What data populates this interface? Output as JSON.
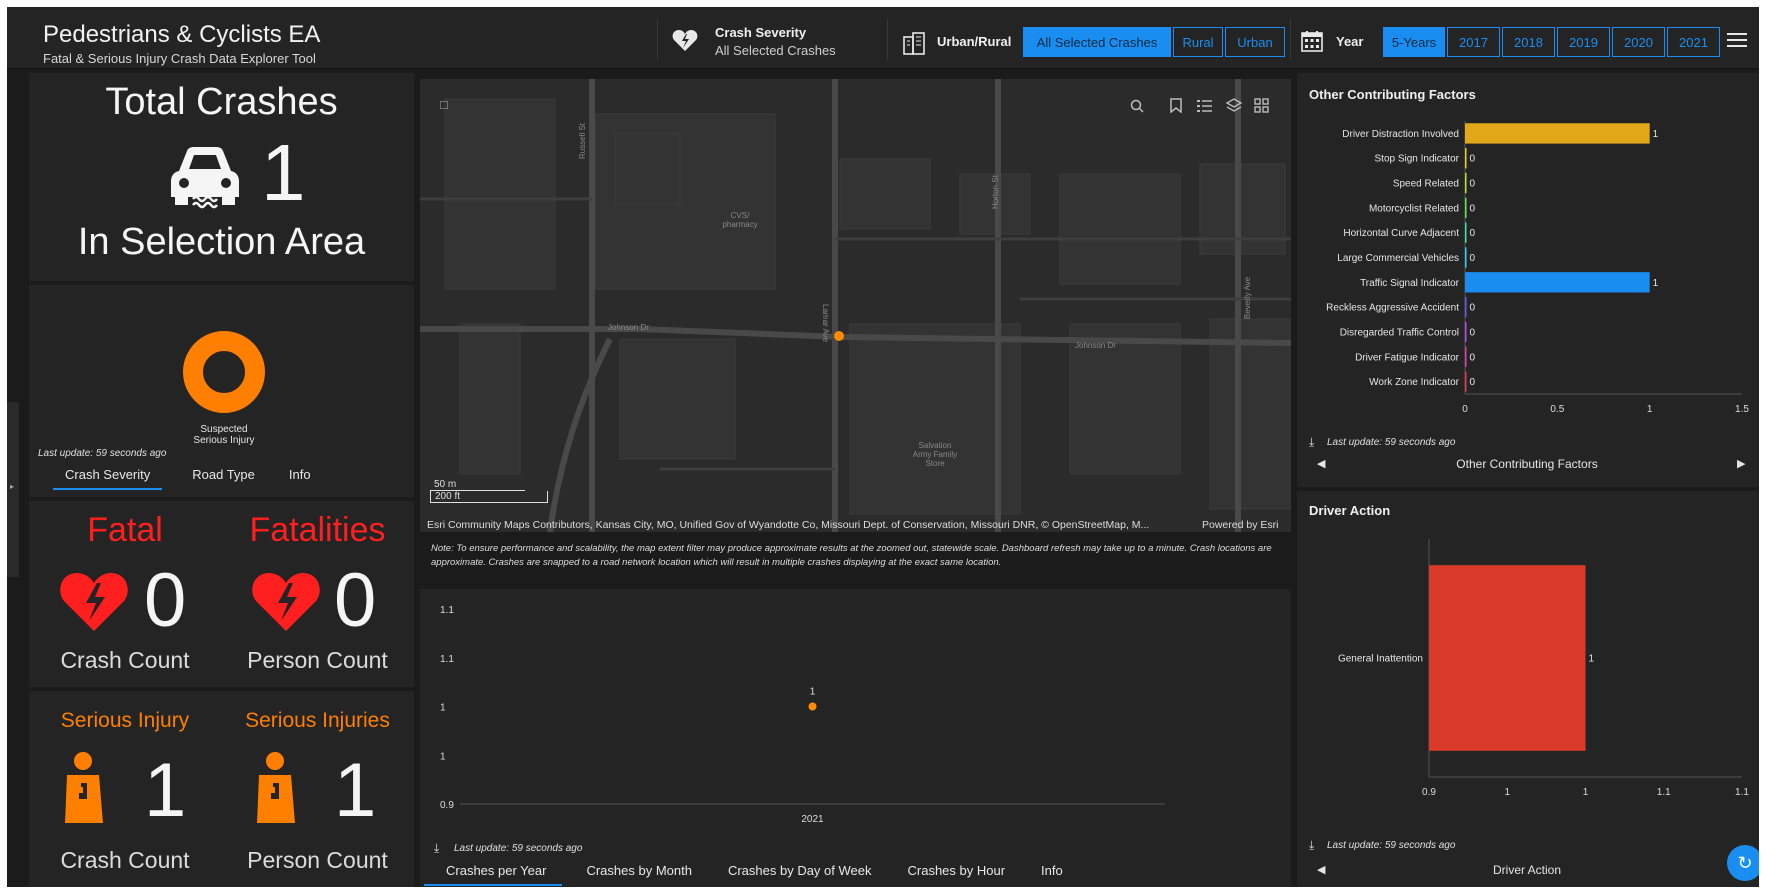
{
  "header": {
    "title": "Pedestrians & Cyclists EA",
    "subtitle": "Fatal & Serious Injury Crash Data Explorer Tool",
    "severity_label": "Crash Severity",
    "severity_value": "All Selected Crashes",
    "urban_rural_label": "Urban/Rural",
    "urban_rural_options": [
      "All Selected Crashes",
      "Rural",
      "Urban"
    ],
    "urban_rural_selected": "All Selected Crashes",
    "year_label": "Year",
    "year_options": [
      "5-Years",
      "2017",
      "2018",
      "2019",
      "2020",
      "2021"
    ],
    "year_selected": "5-Years"
  },
  "total": {
    "title": "Total Crashes",
    "count": "1",
    "subtitle": "In Selection Area"
  },
  "severity_chart": {
    "label_line1": "Suspected",
    "label_line2": "Serious Injury",
    "last_update": "Last update: 59 seconds ago",
    "tabs": [
      "Crash Severity",
      "Road Type",
      "Info"
    ],
    "active_tab": "Crash Severity",
    "slices": [
      {
        "label": "Suspected Serious Injury",
        "value": 1,
        "color": "#ff7f00"
      }
    ]
  },
  "fatal": {
    "title_left": "Fatal",
    "title_right": "Fatalities",
    "count_left": "0",
    "count_right": "0",
    "cap_left": "Crash Count",
    "cap_right": "Person Count",
    "color": "#ff1f1f"
  },
  "serious": {
    "title_left": "Serious Injury",
    "title_right": "Serious Injuries",
    "count_left": "1",
    "count_right": "1",
    "cap_left": "Crash Count",
    "cap_right": "Person Count",
    "color": "#ff7f00"
  },
  "map": {
    "streets": [
      "Russell St",
      "Lamar Ave",
      "Horton St",
      "Beverly Ave",
      "Johnson Dr",
      "Johnson Dr"
    ],
    "places": [
      "CVS/",
      "pharmacy",
      "Salvation",
      "Army Family",
      "Store"
    ],
    "scale_m": "50 m",
    "scale_ft": "200 ft",
    "attribution": "Esri Community Maps Contributors, Kansas City, MO, Unified Gov of Wyandotte Co, Missouri Dept. of Conservation, Missouri DNR, © OpenStreetMap, M...",
    "powered": "Powered by Esri",
    "note": "Note: To ensure performance and scalability, the map extent filter may produce approximate results at the zoomed out, statewide scale. Dashboard refresh may take up to a minute. Crash locations are approximate. Crashes are snapped to a road network location which will result in multiple crashes displaying at the exact same location.",
    "tools": [
      "search-icon",
      "bookmark-icon",
      "legend-icon",
      "layers-icon",
      "basemap-icon"
    ]
  },
  "time_chart": {
    "last_update": "Last update: 59 seconds ago",
    "tabs": [
      "Crashes per Year",
      "Crashes by Month",
      "Crashes by Day of Week",
      "Crashes by Hour",
      "Info"
    ],
    "active_tab": "Crashes per Year"
  },
  "factors_panel": {
    "title": "Other Contributing Factors",
    "last_update": "Last update: 59 seconds ago",
    "pager_label": "Other Contributing Factors"
  },
  "driver_panel": {
    "title": "Driver Action",
    "last_update": "Last update: 59 seconds ago",
    "pager_label": "Driver Action"
  },
  "chart_data": [
    {
      "type": "scatter",
      "title": "Crashes per Year",
      "x": [
        "2021"
      ],
      "y": [
        1
      ],
      "data_labels": [
        "1"
      ],
      "y_ticks": [
        "1.1",
        "1.1",
        "1",
        "1",
        "0.9"
      ],
      "ylim": [
        0.9,
        1.1
      ],
      "color": "#ff8c00"
    },
    {
      "type": "bar",
      "orientation": "horizontal",
      "title": "Other Contributing Factors",
      "categories": [
        "Driver Distraction Involved",
        "Stop Sign Indicator",
        "Speed Related",
        "Motorcyclist Related",
        "Horizontal Curve Adjacent",
        "Large Commercial Vehicles",
        "Traffic Signal Indicator",
        "Reckless Aggressive Accident",
        "Disregarded Traffic Control",
        "Driver Fatigue Indicator",
        "Work Zone Indicator"
      ],
      "values": [
        1,
        0,
        0,
        0,
        0,
        0,
        1,
        0,
        0,
        0,
        0
      ],
      "colors": [
        "#e3a71a",
        "#e8d21a",
        "#b0e82a",
        "#5ee84a",
        "#2ee8a6",
        "#2ed6e8",
        "#1a8ef0",
        "#5a5cf0",
        "#b04ae8",
        "#e83ab0",
        "#e83a4a"
      ],
      "x_ticks": [
        "0",
        "0.5",
        "1",
        "1.5"
      ],
      "xlim": [
        0,
        1.5
      ]
    },
    {
      "type": "bar",
      "orientation": "horizontal",
      "title": "Driver Action",
      "categories": [
        "General Inattention"
      ],
      "values": [
        1
      ],
      "colors": [
        "#d93a2a"
      ],
      "x_ticks": [
        "0.9",
        "1",
        "1",
        "1.1",
        "1.1"
      ],
      "xlim": [
        0.9,
        1.1
      ]
    }
  ]
}
